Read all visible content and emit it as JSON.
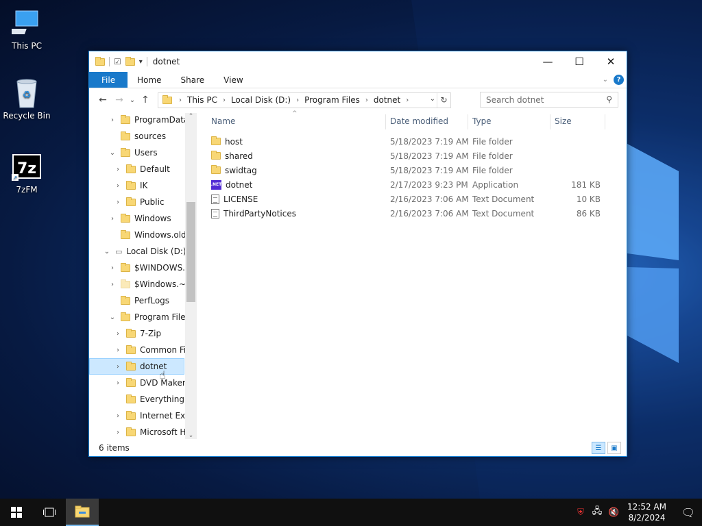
{
  "desktop": {
    "icons": [
      {
        "label": "This PC"
      },
      {
        "label": "Recycle Bin"
      },
      {
        "label": "7zFM"
      }
    ]
  },
  "window": {
    "title": "dotnet",
    "ribbon_tabs": [
      "File",
      "Home",
      "Share",
      "View"
    ],
    "help_label": "?",
    "address": {
      "crumbs": [
        "This PC",
        "Local Disk (D:)",
        "Program Files",
        "dotnet"
      ]
    },
    "search_placeholder": "Search dotnet",
    "nav_tree": [
      {
        "label": "ProgramData",
        "expander": ">"
      },
      {
        "label": "sources",
        "expander": ""
      },
      {
        "label": "Users",
        "expander": "v"
      },
      {
        "label": "Default",
        "expander": ">"
      },
      {
        "label": "IK",
        "expander": ">"
      },
      {
        "label": "Public",
        "expander": ">"
      },
      {
        "label": "Windows",
        "expander": ">"
      },
      {
        "label": "Windows.old",
        "expander": ""
      },
      {
        "label": "Local Disk (D:)",
        "expander": "v"
      },
      {
        "label": "$WINDOWS.~",
        "expander": ">"
      },
      {
        "label": "$Windows.~V",
        "expander": ">"
      },
      {
        "label": "PerfLogs",
        "expander": ""
      },
      {
        "label": "Program Files",
        "expander": "v"
      },
      {
        "label": "7-Zip",
        "expander": ">"
      },
      {
        "label": "Common Fi",
        "expander": ">"
      },
      {
        "label": "dotnet",
        "expander": ">"
      },
      {
        "label": "DVD Maker",
        "expander": ">"
      },
      {
        "label": "Everything",
        "expander": ""
      },
      {
        "label": "Internet Exp",
        "expander": ">"
      },
      {
        "label": "Microsoft H",
        "expander": ">"
      }
    ],
    "columns": {
      "name": "Name",
      "date": "Date modified",
      "type": "Type",
      "size": "Size"
    },
    "files": [
      {
        "name": "host",
        "date": "5/18/2023 7:19 AM",
        "type": "File folder",
        "size": "",
        "icon": "folder"
      },
      {
        "name": "shared",
        "date": "5/18/2023 7:19 AM",
        "type": "File folder",
        "size": "",
        "icon": "folder"
      },
      {
        "name": "swidtag",
        "date": "5/18/2023 7:19 AM",
        "type": "File folder",
        "size": "",
        "icon": "folder"
      },
      {
        "name": "dotnet",
        "date": "2/17/2023 9:23 PM",
        "type": "Application",
        "size": "181 KB",
        "icon": "net-app"
      },
      {
        "name": "LICENSE",
        "date": "2/16/2023 7:06 AM",
        "type": "Text Document",
        "size": "10 KB",
        "icon": "document"
      },
      {
        "name": "ThirdPartyNotices",
        "date": "2/16/2023 7:06 AM",
        "type": "Text Document",
        "size": "86 KB",
        "icon": "document"
      }
    ],
    "net_icon_text": ".NET",
    "status": "6 items"
  },
  "taskbar": {
    "time": "12:52 AM",
    "date": "8/2/2024"
  },
  "colors": {
    "accent": "#1979ca",
    "folder": "#f8d775",
    "selection": "#cce8ff",
    "net_purple": "#512bd4"
  }
}
